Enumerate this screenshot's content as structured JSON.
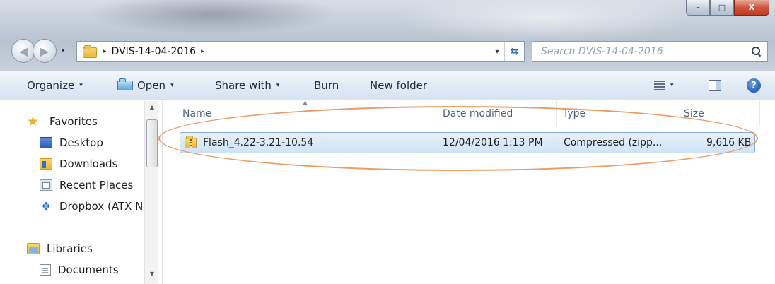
{
  "window": {
    "controls": {
      "minimize": "–",
      "maximize": "□",
      "close": "X"
    }
  },
  "address": {
    "path": "DVIS-14-04-2016",
    "separator": "▸",
    "dropdown": "▾",
    "refresh": "⇆"
  },
  "search": {
    "placeholder": "Search DVIS-14-04-2016"
  },
  "toolbar": {
    "organize": "Organize",
    "open": "Open",
    "share_with": "Share with",
    "burn": "Burn",
    "new_folder": "New folder",
    "arrow": "▾",
    "help": "?"
  },
  "navigation": {
    "favorites": [
      {
        "label": "Favorites",
        "icon": "star-icon"
      },
      {
        "label": "Desktop",
        "icon": "desktop-icon"
      },
      {
        "label": "Downloads",
        "icon": "downloads-icon"
      },
      {
        "label": "Recent Places",
        "icon": "recent-places-icon"
      },
      {
        "label": "Dropbox (ATX N",
        "icon": "dropbox-icon"
      }
    ],
    "libraries": [
      {
        "label": "Libraries",
        "icon": "libraries-icon"
      },
      {
        "label": "Documents",
        "icon": "documents-icon"
      }
    ],
    "scroll_up": "▲",
    "scroll_down": "▼"
  },
  "columns": {
    "name": "Name",
    "date_modified": "Date modified",
    "type": "Type",
    "size": "Size",
    "sort_indicator": "▲"
  },
  "files": [
    {
      "name": "Flash_4.22-3.21-10.54",
      "date_modified": "12/04/2016 1:13 PM",
      "type": "Compressed (zipp...",
      "size": "9,616 KB",
      "icon": "zip-folder-icon"
    }
  ],
  "colors": {
    "highlight_ellipse": "#ea9c63",
    "selection_border": "#84acdd",
    "toolbar_bg": "#dfe9f5",
    "close_button": "#c03b22"
  }
}
